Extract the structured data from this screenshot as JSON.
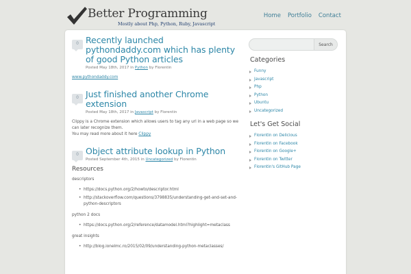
{
  "header": {
    "site_title": "Better Programming",
    "tagline": "Mostly about Php, Python, Ruby, Javascript",
    "nav": [
      {
        "label": "Home"
      },
      {
        "label": "Portfolio"
      },
      {
        "label": "Contact"
      }
    ]
  },
  "posts": [
    {
      "comment_count": "0",
      "title": "Recently launched pythondaddy.com which has plenty of good Python articles",
      "meta_prefix": "Posted May 18th, 2017 in",
      "category": "Python",
      "meta_by": "by Florentin",
      "body_link": "www.pythondaddy.com"
    },
    {
      "comment_count": "0",
      "title": "Just finished another Chrome extension",
      "meta_prefix": "Posted May 18th, 2017 in",
      "category": "Javascript",
      "meta_by": "by Florentin",
      "body_line1": "Clippy is a Chrome extension which allows users to tag any url in a web page so we can later recognize them.",
      "body_line2_prefix": "You may read more about it here",
      "body_link": "Clippy"
    },
    {
      "comment_count": "0",
      "title": "Object attribute lookup in Python",
      "meta_prefix": "Posted September 4th, 2015 in",
      "category": "Uncategorized",
      "meta_by": "by Florentin",
      "resources_heading": "Resources",
      "group1_label": "descriptors",
      "group1_links": [
        "https://docs.python.org/2/howto/descriptor.html",
        "http://stackoverflow.com/questions/3798835/understanding-get-and-set-and-python-descriptors"
      ],
      "group2_label": "python 2 docs",
      "group2_links": [
        "https://docs.python.org/2/reference/datamodel.html?highlight=metaclass"
      ],
      "group3_label": "great insights",
      "group3_links": [
        "http://blog.ionelmc.ro/2015/02/09/understanding-python-metaclasses/"
      ]
    }
  ],
  "sidebar": {
    "search_button": "Search",
    "search_placeholder": "",
    "categories_title": "Categories",
    "categories": [
      "Funny",
      "Javascript",
      "Php",
      "Python",
      "Ubuntu",
      "Uncategorized"
    ],
    "social_title": "Let's Get Social",
    "social": [
      "Florentin on Delicious",
      "Florentin on Facebook",
      "Florentin on Google+",
      "Florentin on Twitter",
      "Florentin's GitHub Page"
    ]
  }
}
